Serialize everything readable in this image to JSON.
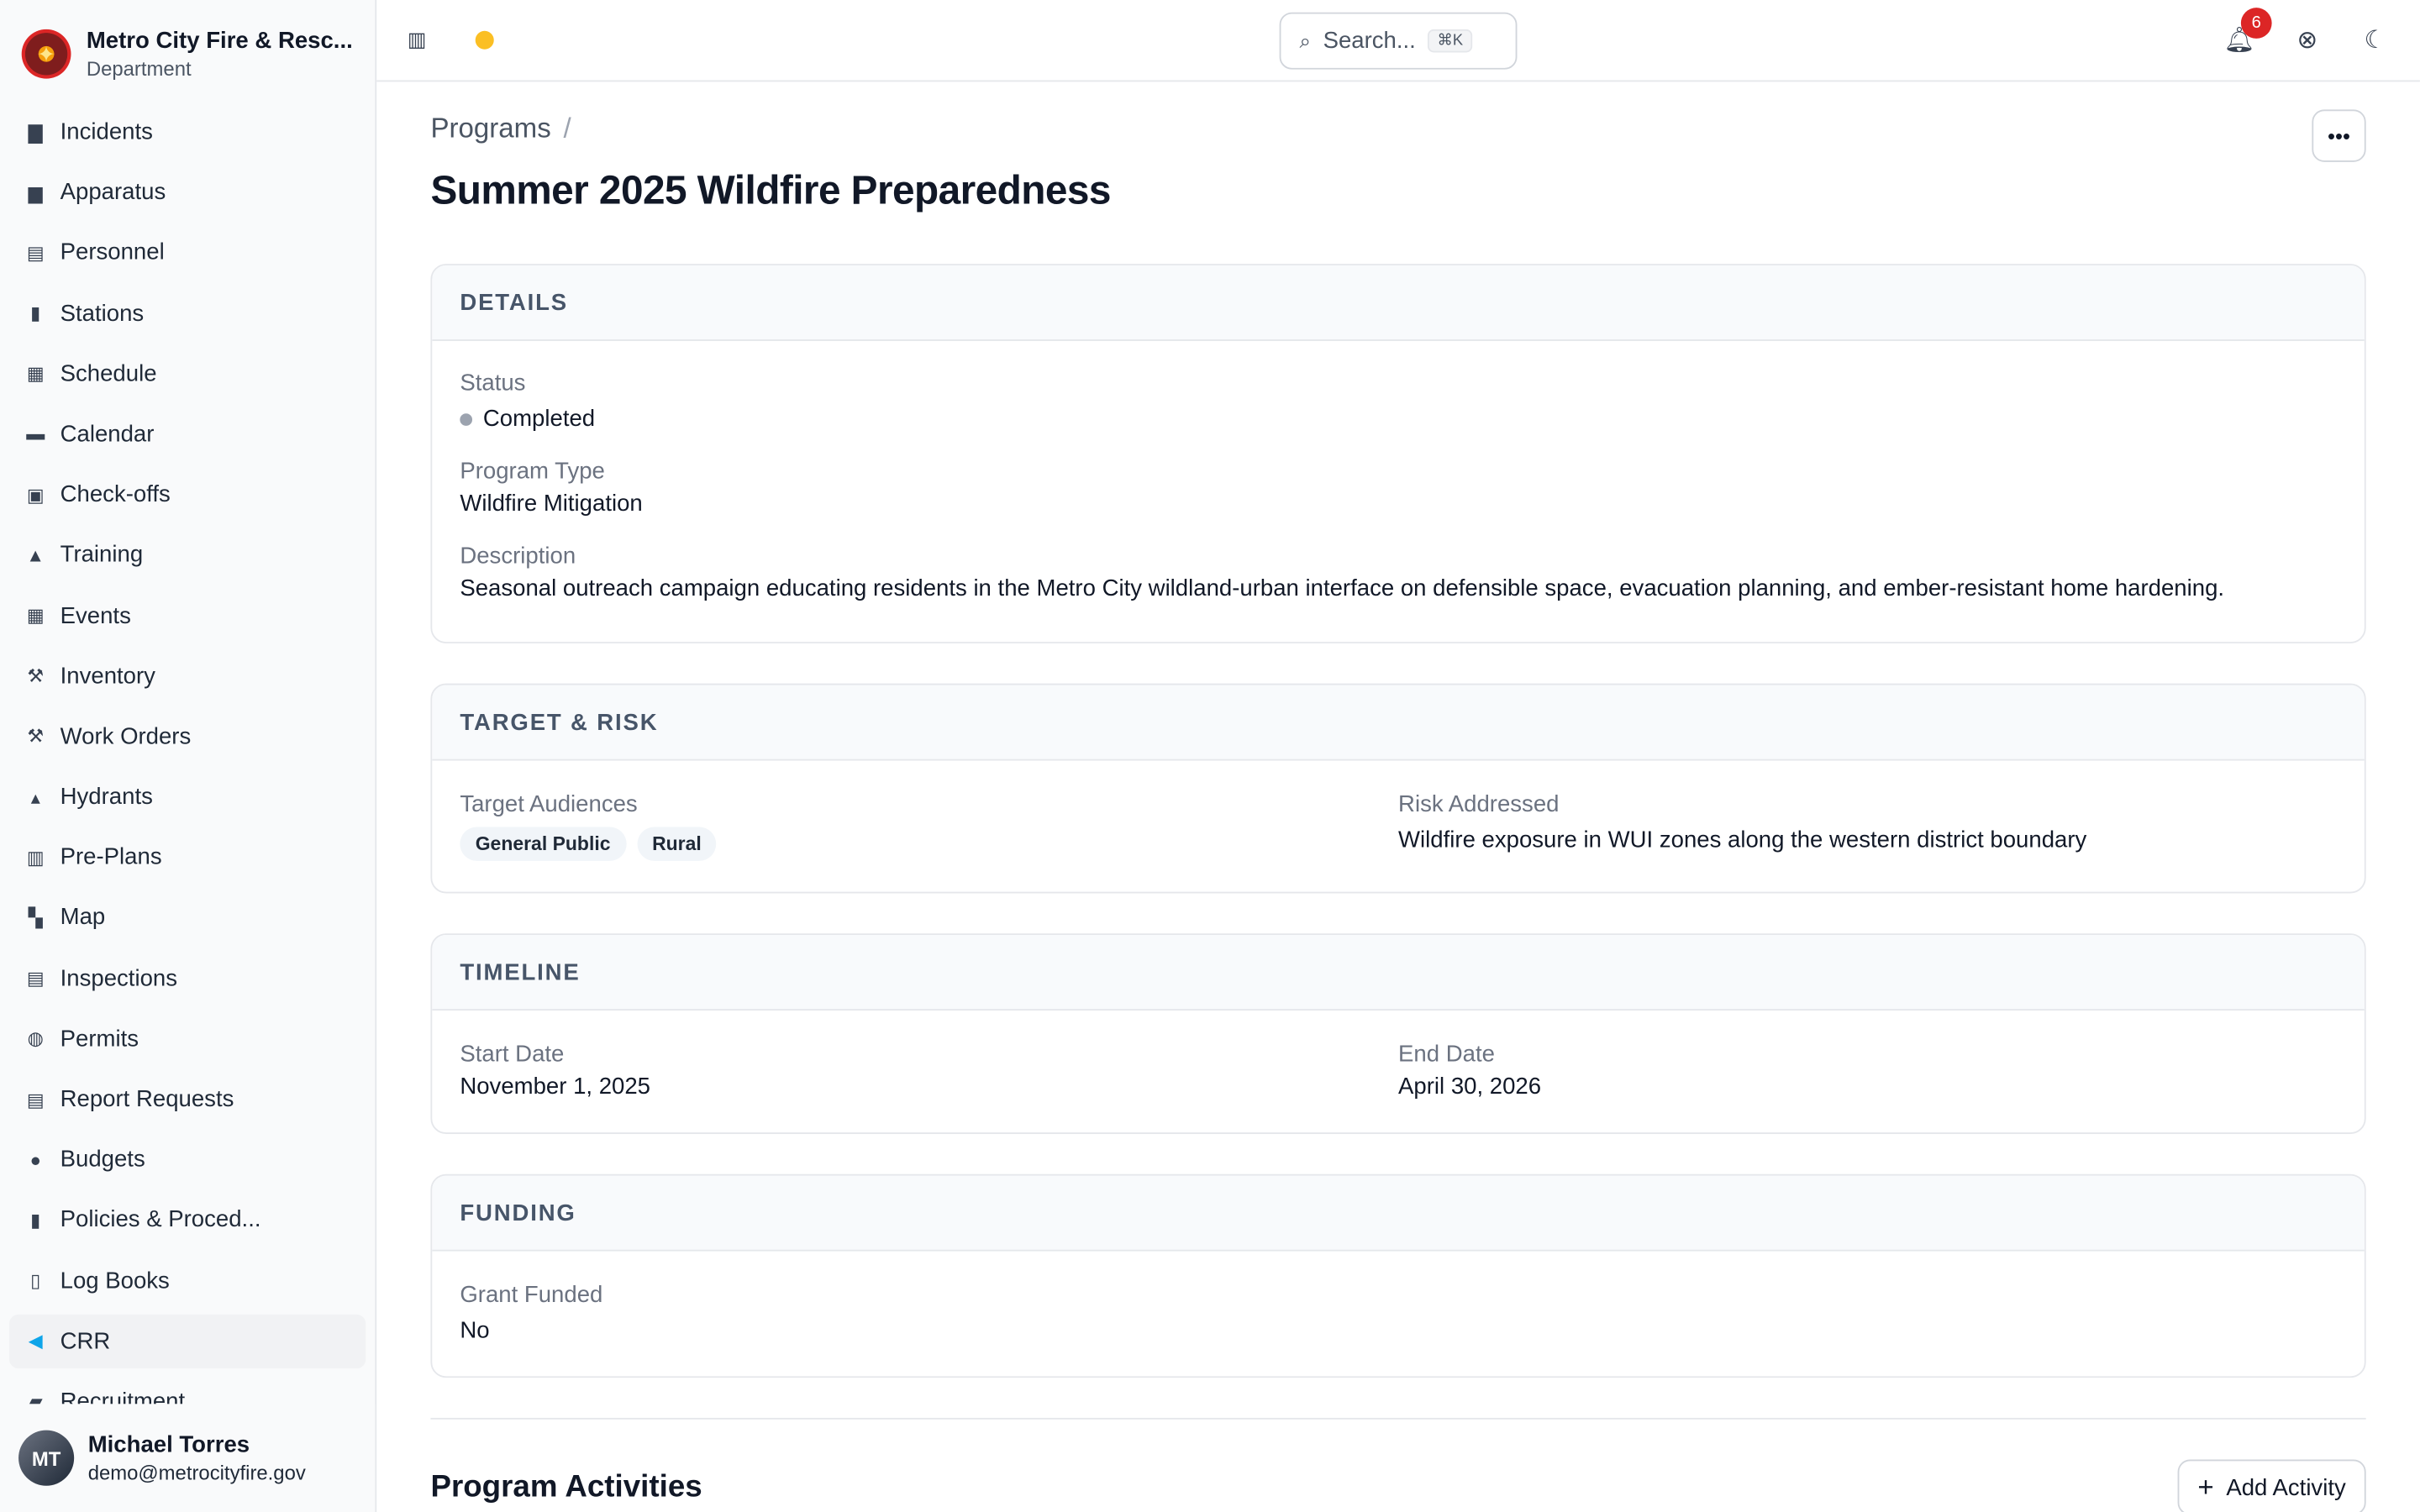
{
  "org": {
    "name": "Metro City Fire & Resc...",
    "subtitle": "Department"
  },
  "nav": {
    "items": [
      {
        "label": "Incidents",
        "icon": "incidents-icon"
      },
      {
        "label": "Apparatus",
        "icon": "apparatus-icon"
      },
      {
        "label": "Personnel",
        "icon": "personnel-icon"
      },
      {
        "label": "Stations",
        "icon": "stations-icon"
      },
      {
        "label": "Schedule",
        "icon": "schedule-icon"
      },
      {
        "label": "Calendar",
        "icon": "calendar-icon"
      },
      {
        "label": "Check-offs",
        "icon": "checkoffs-icon"
      },
      {
        "label": "Training",
        "icon": "training-icon"
      },
      {
        "label": "Events",
        "icon": "events-icon"
      },
      {
        "label": "Inventory",
        "icon": "inventory-icon"
      },
      {
        "label": "Work Orders",
        "icon": "work-orders-icon"
      },
      {
        "label": "Hydrants",
        "icon": "hydrants-icon"
      },
      {
        "label": "Pre-Plans",
        "icon": "pre-plans-icon"
      },
      {
        "label": "Map",
        "icon": "map-icon"
      },
      {
        "label": "Inspections",
        "icon": "inspections-icon"
      },
      {
        "label": "Permits",
        "icon": "permits-icon"
      },
      {
        "label": "Report Requests",
        "icon": "report-requests-icon"
      },
      {
        "label": "Budgets",
        "icon": "budgets-icon"
      },
      {
        "label": "Policies & Proced...",
        "icon": "policies-icon"
      },
      {
        "label": "Log Books",
        "icon": "log-books-icon"
      },
      {
        "label": "CRR",
        "icon": "megaphone-icon"
      },
      {
        "label": "Recruitment",
        "icon": "recruitment-icon"
      }
    ],
    "active": "CRR"
  },
  "user": {
    "name": "Michael Torres",
    "email": "demo@metrocityfire.gov"
  },
  "topbar": {
    "search_placeholder": "Search...",
    "search_shortcut": "⌘K",
    "notification_count": "6",
    "theme_color": "#fbbf24"
  },
  "breadcrumb": {
    "parent": "Programs",
    "separator": "/"
  },
  "page_title": "Summer 2025 Wildfire Preparedness",
  "details": {
    "heading": "DETAILS",
    "status_label": "Status",
    "status_value": "Completed",
    "program_type_label": "Program Type",
    "program_type_value": "Wildfire Mitigation",
    "description_label": "Description",
    "description_value": "Seasonal outreach campaign educating residents in the Metro City wildland-urban interface on defensible space, evacuation planning, and ember-resistant home hardening."
  },
  "target_risk": {
    "heading": "TARGET & RISK",
    "audiences_label": "Target Audiences",
    "audiences": [
      "General Public",
      "Rural"
    ],
    "risk_label": "Risk Addressed",
    "risk_value": "Wildfire exposure in WUI zones along the western district boundary"
  },
  "timeline": {
    "heading": "TIMELINE",
    "start_label": "Start Date",
    "start_value": "November 1, 2025",
    "end_label": "End Date",
    "end_value": "April 30, 2026"
  },
  "funding": {
    "heading": "FUNDING",
    "grant_label": "Grant Funded",
    "grant_value": "No"
  },
  "activities": {
    "title": "Program Activities",
    "add_label": "Add Activity"
  },
  "colors": {
    "accent": "#0ea5e9",
    "badge": "#dc2626",
    "status_completed": "#9ca3af"
  }
}
